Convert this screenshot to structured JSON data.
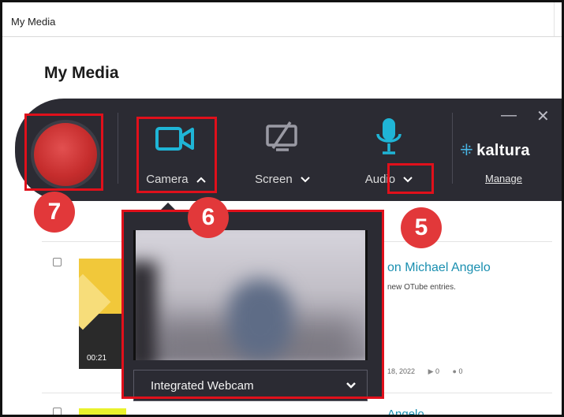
{
  "header": {
    "breadcrumb": "My Media"
  },
  "page": {
    "title": "My Media"
  },
  "entries": [
    {
      "title": "on Michael Angelo",
      "subtitle": "new OTube entries.",
      "duration": "00:21",
      "date": "18, 2022",
      "plays": "0",
      "comments": "0"
    },
    {
      "title": "Angelo"
    }
  ],
  "toolbar": {
    "camera_label": "Camera",
    "screen_label": "Screen",
    "audio_label": "Audio",
    "brand": "kaltura",
    "manage_label": "Manage",
    "minimize": "—",
    "close": "✕"
  },
  "camera_panel": {
    "selected_device": "Integrated Webcam"
  },
  "annotations": {
    "n5": "5",
    "n6": "6",
    "n7": "7"
  },
  "colors": {
    "accent": "#1fb5d6",
    "record": "#c62d2d",
    "annotation": "#e0101b",
    "toolbar_bg": "#2b2b33"
  }
}
